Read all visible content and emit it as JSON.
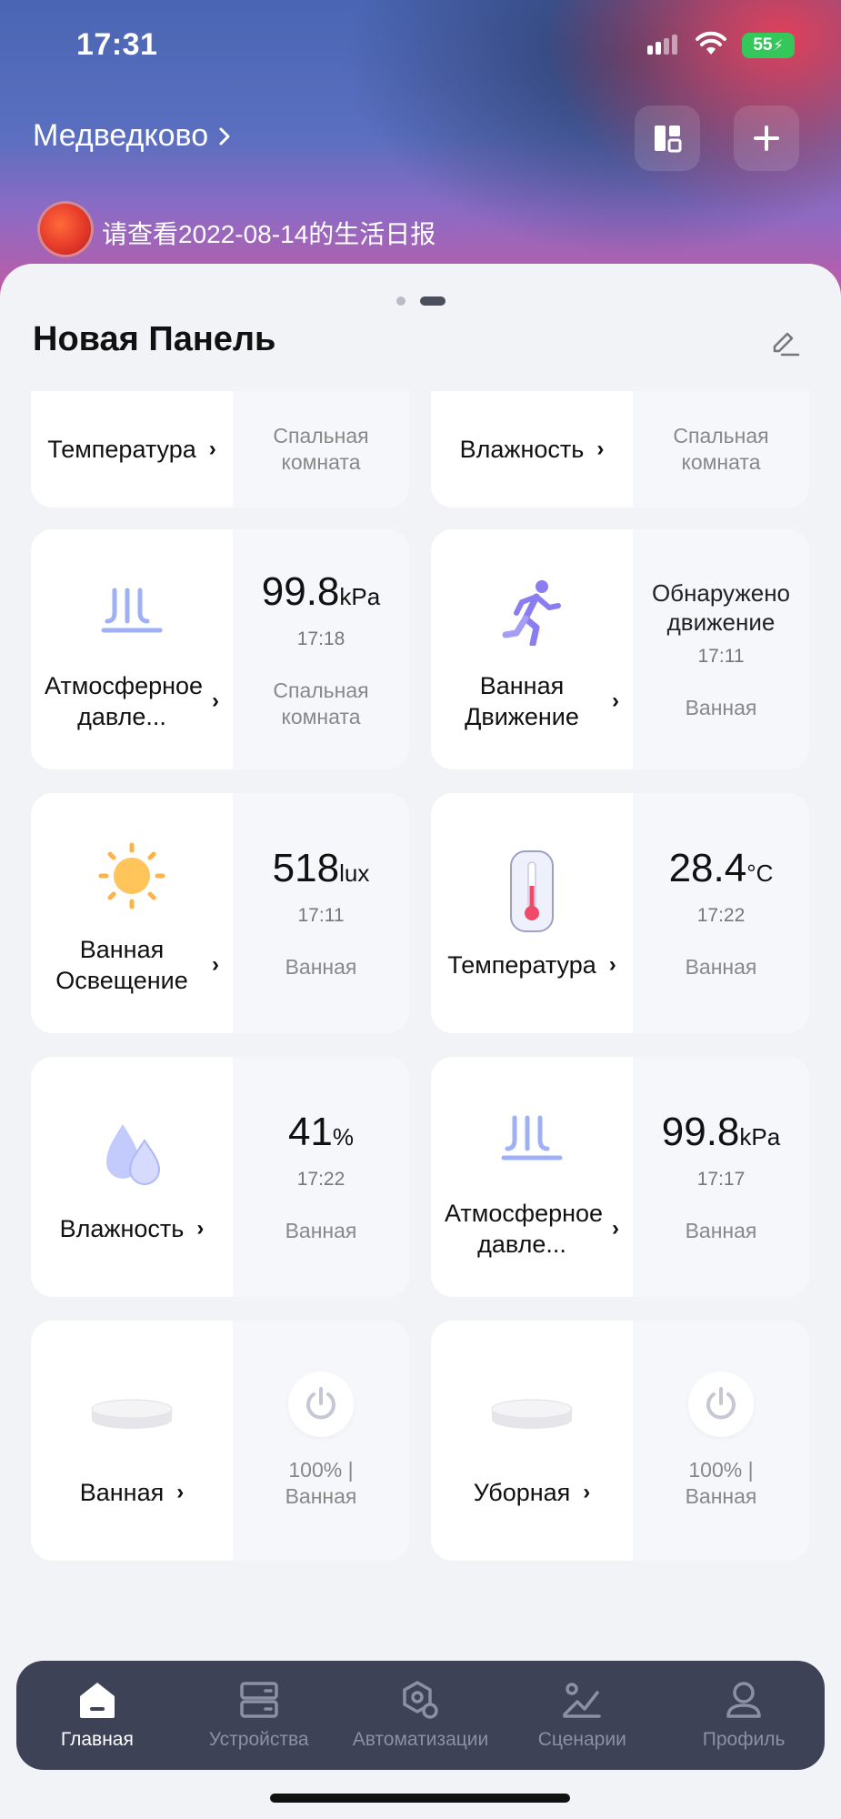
{
  "status": {
    "time": "17:31",
    "battery": "55"
  },
  "header": {
    "location": "Медведково",
    "banner_text": "请查看2022-08-14的生活日报"
  },
  "panel": {
    "title": "Новая Панель",
    "page_count": 2,
    "active_page": 2
  },
  "cards": {
    "c1": {
      "name": "Температура",
      "room": "Спальная комната"
    },
    "c2": {
      "name": "Влажность",
      "room": "Спальная комната"
    },
    "c3": {
      "name": "Атмосферное давле...",
      "value": "99.8",
      "unit": "kPa",
      "time": "17:18",
      "room": "Спальная комната",
      "icon": "pressure-icon"
    },
    "c4": {
      "name": "Ванная Движение",
      "value": "Обнаружено движение",
      "time": "17:11",
      "room": "Ванная",
      "icon": "motion-icon"
    },
    "c5": {
      "name": "Ванная Освещение",
      "value": "518",
      "unit": "lux",
      "time": "17:11",
      "room": "Ванная",
      "icon": "sun-icon"
    },
    "c6": {
      "name": "Температура",
      "value": "28.4",
      "unit": "°C",
      "time": "17:22",
      "room": "Ванная",
      "icon": "thermometer-icon"
    },
    "c7": {
      "name": "Влажность",
      "value": "41",
      "unit": "%",
      "time": "17:22",
      "room": "Ванная",
      "icon": "humidity-icon"
    },
    "c8": {
      "name": "Атмосферное давле...",
      "value": "99.8",
      "unit": "kPa",
      "time": "17:17",
      "room": "Ванная",
      "icon": "pressure-icon"
    },
    "c9": {
      "name": "Ванная",
      "status": "100% | Ванная",
      "icon": "ceiling-light-icon"
    },
    "c10": {
      "name": "Уборная",
      "status": "100% | Ванная",
      "icon": "ceiling-light-icon"
    }
  },
  "tabs": [
    {
      "label": "Главная",
      "icon": "home-icon",
      "active": true
    },
    {
      "label": "Устройства",
      "icon": "devices-icon",
      "active": false
    },
    {
      "label": "Автоматизации",
      "icon": "automation-icon",
      "active": false
    },
    {
      "label": "Сценарии",
      "icon": "scenes-icon",
      "active": false
    },
    {
      "label": "Профиль",
      "icon": "profile-icon",
      "active": false
    }
  ],
  "colors": {
    "accent": "#4b4f5c",
    "tabbar": "#3d4257",
    "battery": "#34c759"
  }
}
